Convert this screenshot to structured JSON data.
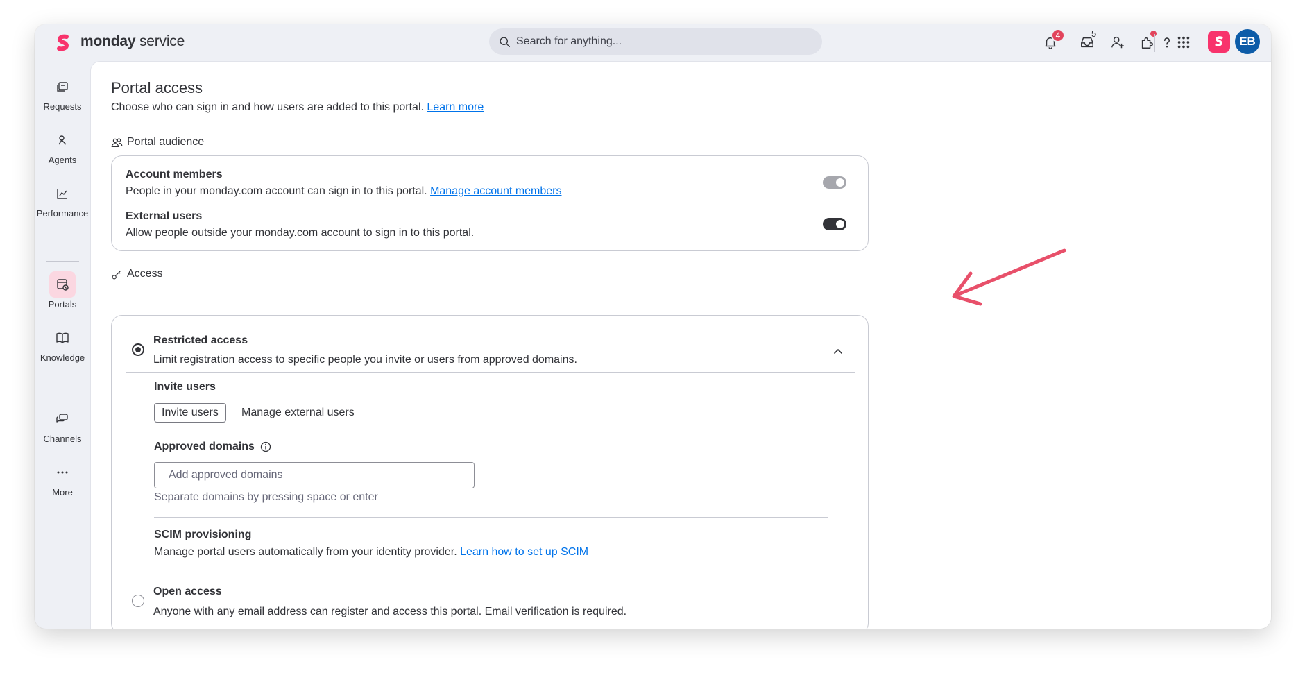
{
  "topbar": {
    "brand_bold": "monday",
    "brand_rest": " service",
    "search_placeholder": "Search for anything...",
    "notifications_count": "4",
    "inbox_count": "5",
    "avatar_initials": "EB",
    "icons": [
      "bell-icon",
      "inbox-icon",
      "invite-member-icon",
      "apps-puzzle-icon",
      "help-icon",
      "app-grid-icon"
    ]
  },
  "sidebar": {
    "items": [
      {
        "label": "Requests",
        "icon": "requests-icon"
      },
      {
        "label": "Agents",
        "icon": "agents-icon"
      },
      {
        "label": "Performance",
        "icon": "performance-icon"
      },
      {
        "label": "Portals",
        "icon": "portals-icon",
        "active": true
      },
      {
        "label": "Knowledge",
        "icon": "knowledge-book-icon"
      },
      {
        "label": "Channels",
        "icon": "channels-icon"
      },
      {
        "label": "More",
        "icon": "more-dots-icon"
      }
    ]
  },
  "page": {
    "title": "Portal access",
    "subtitle": "Choose who can sign in and how users are added to this portal.",
    "learn_more": "Learn more"
  },
  "audience": {
    "section_title": "Portal audience",
    "account_members_title": "Account members",
    "account_members_desc": "People in your monday.com account can sign in to this portal.",
    "account_members_link": "Manage account members",
    "account_members_enabled": true,
    "external_users_title": "External users",
    "external_users_desc": "Allow people outside your monday.com account to sign in to this portal.",
    "external_users_enabled": true
  },
  "access": {
    "section_title": "Access",
    "restricted_title": "Restricted access",
    "restricted_desc": "Limit registration access to specific people you invite or users from approved domains.",
    "restricted_selected": true,
    "invite_users_heading": "Invite users",
    "invite_users_button": "Invite users",
    "manage_external_users": "Manage external users",
    "approved_domains_heading": "Approved domains",
    "approved_domains_placeholder": "Add approved domains",
    "approved_domains_hint": "Separate domains by pressing space or enter",
    "scim_heading": "SCIM provisioning",
    "scim_desc": "Manage portal users automatically from your identity provider.",
    "scim_link": "Learn how to set up SCIM",
    "open_title": "Open access",
    "open_desc": "Anyone with any email address can register and access this portal. Email verification is required.",
    "open_selected": false
  },
  "colors": {
    "accent_link": "#0073ea",
    "toggle_on": "#323338",
    "toggle_disabled": "#a6a7ad",
    "annotation_arrow": "#e8506a",
    "brand_pink": "#f8336c",
    "avatar_blue": "#0d5ca8"
  }
}
